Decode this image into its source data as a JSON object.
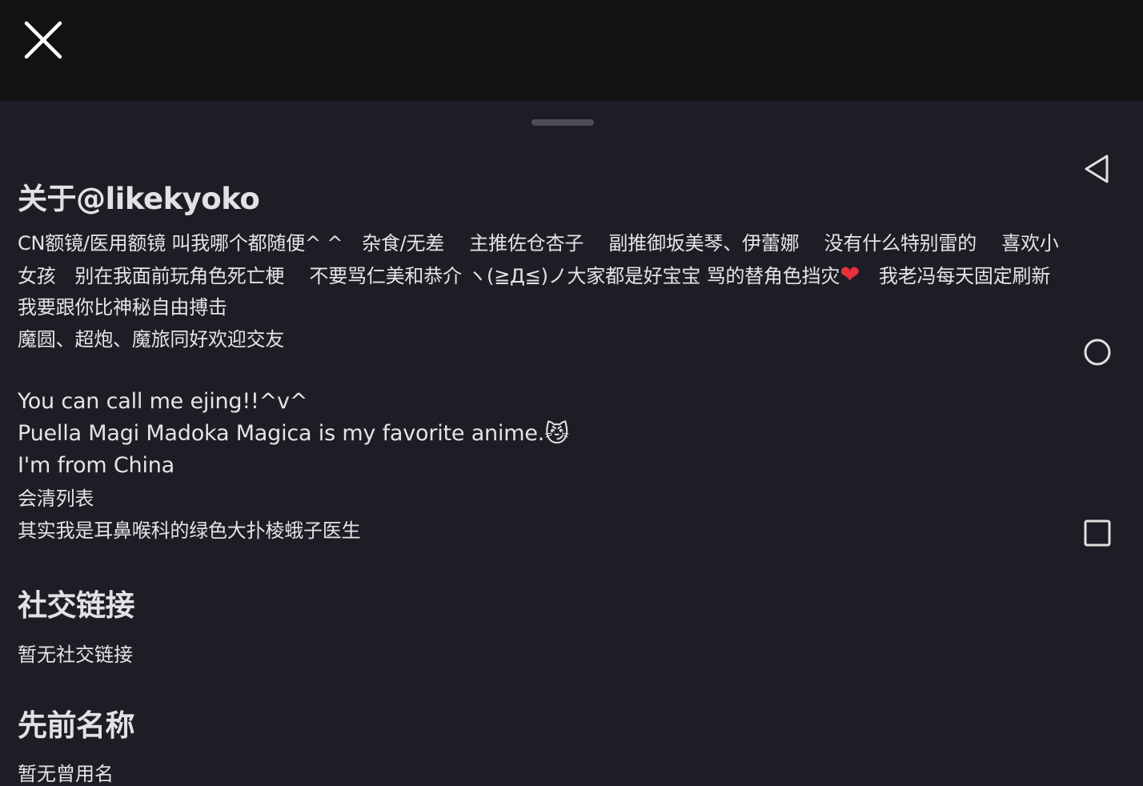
{
  "icons": {
    "close": "close-icon",
    "back": "back-triangle-icon",
    "home": "home-circle-icon",
    "recents": "recents-square-icon"
  },
  "colors": {
    "background": "#1d1e25",
    "top_bar": "#121212",
    "heart": "#e8303c"
  },
  "about": {
    "title": "关于@likekyoko",
    "lines": [
      "CN额镜/医用额镜 叫我哪个都随便^ ^　杂食/无差　 主推佐仓杏子　 副推御坂美琴、伊蕾娜　 没有什么特别雷的　 喜欢小",
      "女孩　别在我面前玩角色死亡梗　 不要骂仁美和恭介 ヽ(≧Д≦)ノ大家都是好宝宝 骂的替角色挡灾",
      "我要跟你比神秘自由搏击",
      "魔圆、超炮、魔旅同好欢迎交友"
    ],
    "line2_heart": "❤",
    "line2_tail": "　我老冯每天固定刷新",
    "en_lines": [
      "You can call me ejing!!^v^",
      "Puella Magi Madoka Magica is my favorite anime.",
      "I'm from China"
    ],
    "cat_emoji": "😼",
    "tail_lines": [
      "会清列表",
      "其实我是耳鼻喉科的绿色大扑棱蛾子医生"
    ]
  },
  "social": {
    "title": "社交链接",
    "empty": "暂无社交链接"
  },
  "previous_names": {
    "title": "先前名称",
    "empty": "暂无曾用名"
  }
}
